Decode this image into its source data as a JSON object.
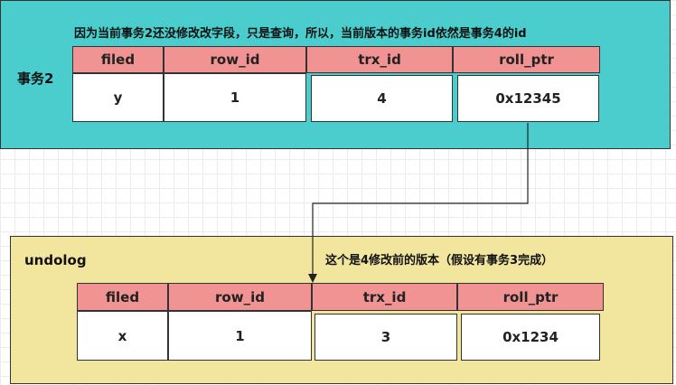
{
  "transaction": {
    "label": "事务2",
    "note": "因为当前事务2还没修改改字段，只是查询，所以，当前版本的事务id依然是事务4的id",
    "headers": [
      "filed",
      "row_id",
      "trx_id",
      "roll_ptr"
    ],
    "values": [
      "y",
      "1",
      "4",
      "0x12345"
    ]
  },
  "undolog": {
    "label": "undolog",
    "note": "这个是4修改前的版本（假设有事务3完成）",
    "headers": [
      "filed",
      "row_id",
      "trx_id",
      "roll_ptr"
    ],
    "values": [
      "x",
      "1",
      "3",
      "0x1234"
    ]
  },
  "colors": {
    "transaction_bg": "#4bcdcd",
    "undolog_bg": "#f2e59d",
    "header_bg": "#f19393",
    "value_bg": "#ffffff"
  }
}
